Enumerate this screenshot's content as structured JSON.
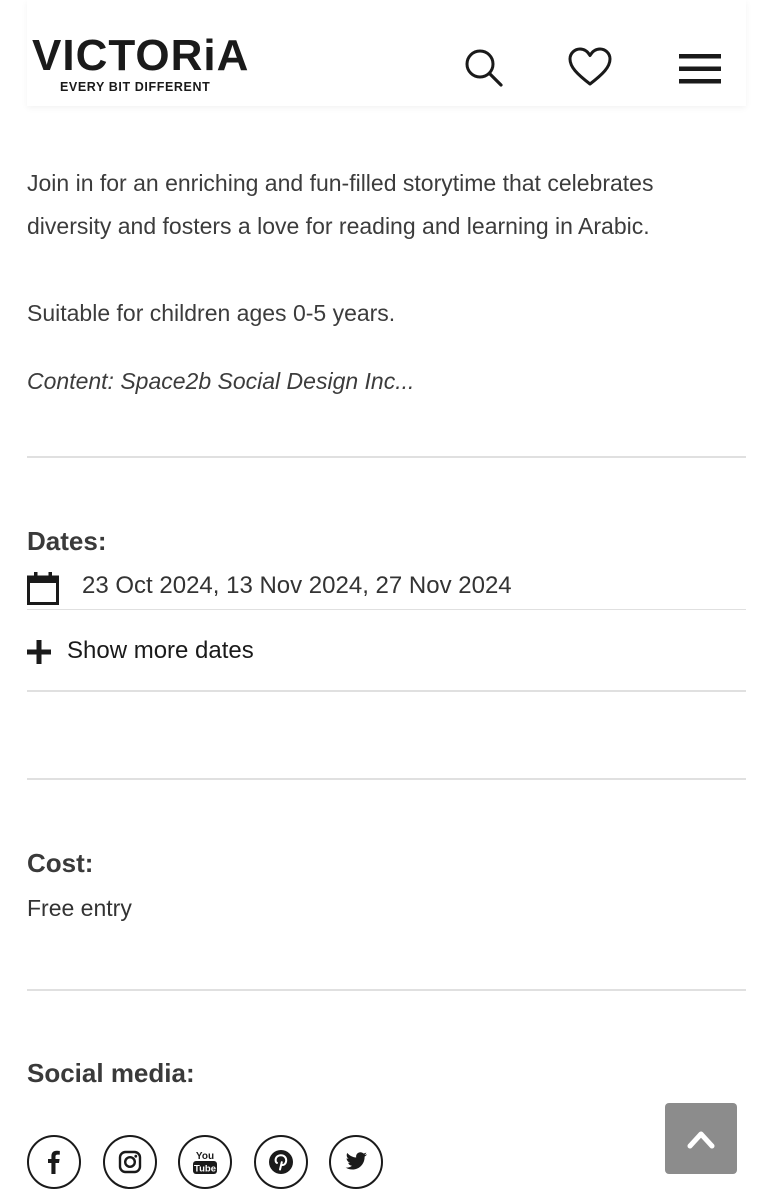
{
  "header": {
    "logo_text": "VICTORiA",
    "tagline": "EVERY BIT DIFFERENT",
    "icons": [
      "search-icon",
      "heart-icon",
      "menu-icon"
    ]
  },
  "description": {
    "intro": "Join in for an enriching and fun-filled storytime that celebrates diversity and fosters a love for reading and learning in Arabic.",
    "ages": "Suitable for children ages 0-5 years.",
    "credit": "Content: Space2b Social Design Inc..."
  },
  "dates": {
    "heading": "Dates:",
    "icon": "calendar-icon",
    "list": "23 Oct 2024, 13 Nov 2024, 27 Nov 2024",
    "show_more_label": "Show more dates"
  },
  "cost": {
    "heading": "Cost:",
    "value": "Free entry"
  },
  "social": {
    "heading": "Social media:",
    "icons": [
      "facebook-icon",
      "instagram-icon",
      "youtube-icon",
      "pinterest-icon",
      "twitter-icon"
    ],
    "youtube_text": [
      "You",
      "Tube"
    ]
  },
  "colors": {
    "text": "#333333",
    "divider": "#e0e0e0",
    "back_to_top_bg": "#8c8c8c"
  }
}
